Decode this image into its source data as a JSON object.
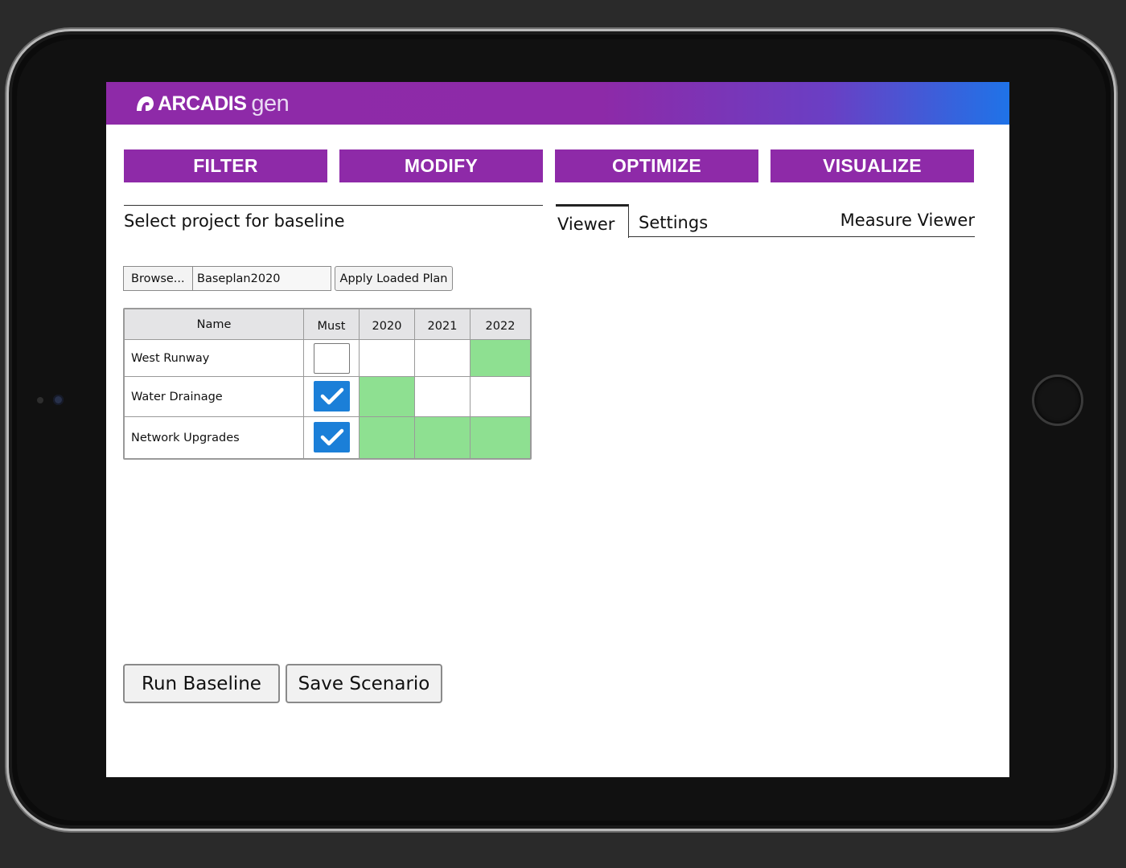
{
  "app": {
    "brand": "ARCADIS",
    "brand_sub": "gen"
  },
  "nav": {
    "items": [
      {
        "label": "FILTER"
      },
      {
        "label": "MODIFY"
      },
      {
        "label": "OPTIMIZE"
      },
      {
        "label": "VISUALIZE"
      }
    ]
  },
  "baseline": {
    "title": "Select project for baseline",
    "browse_label": "Browse...",
    "file_value": "Baseplan2020",
    "apply_label": "Apply Loaded Plan",
    "table": {
      "headers": [
        "Name",
        "Must",
        "2020",
        "2021",
        "2022"
      ],
      "rows": [
        {
          "name": "West Runway",
          "must": false,
          "years": [
            false,
            false,
            true
          ]
        },
        {
          "name": "Water Drainage",
          "must": true,
          "years": [
            true,
            false,
            false
          ]
        },
        {
          "name": "Network Upgrades",
          "must": true,
          "years": [
            true,
            true,
            true
          ]
        }
      ]
    },
    "run_label": "Run Baseline",
    "save_label": "Save Scenario"
  },
  "viewer": {
    "tabs": [
      {
        "label": "Viewer",
        "active": true
      },
      {
        "label": "Settings",
        "active": false
      }
    ],
    "title": "Measure Viewer"
  },
  "colors": {
    "brand_purple": "#8e2aa8",
    "gradient_end": "#1f73e8",
    "selected_green": "#8ee091",
    "checkbox_blue": "#1b7fd8"
  }
}
